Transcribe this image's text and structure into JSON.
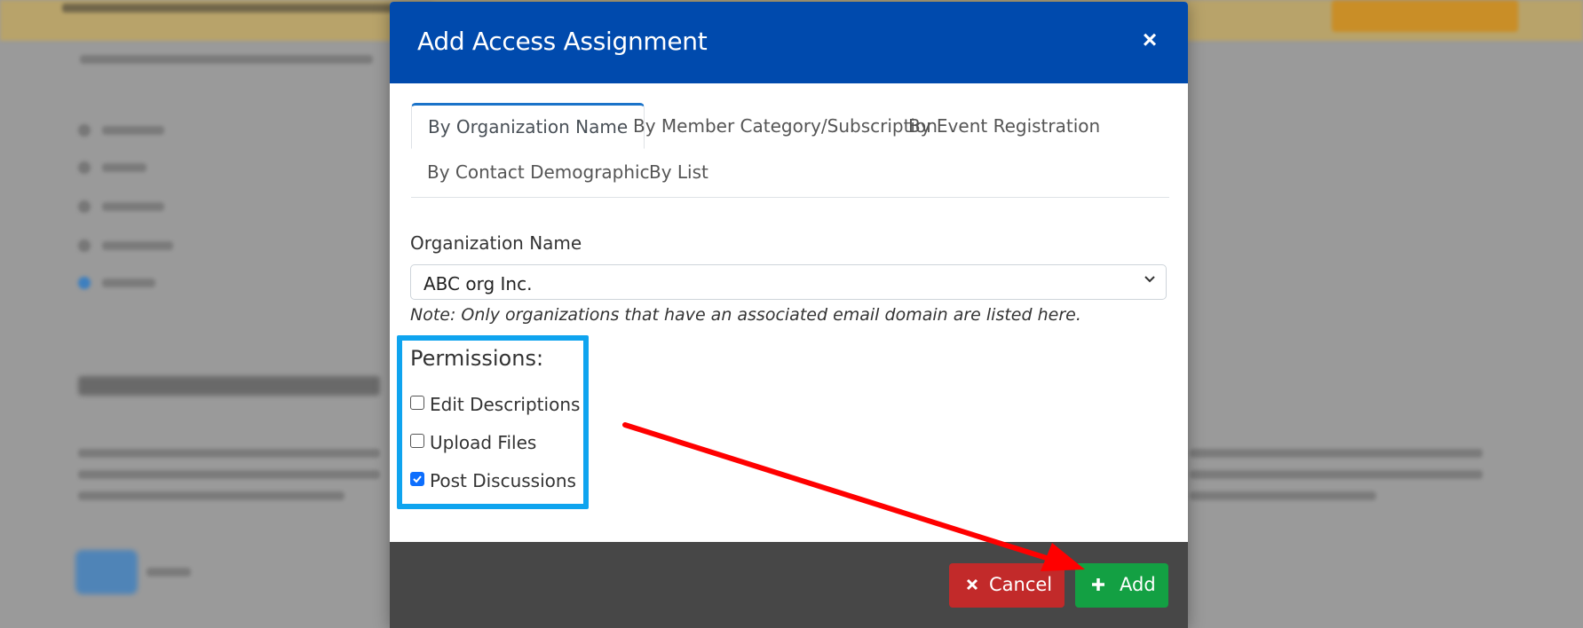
{
  "modal": {
    "title": "Add Access Assignment",
    "close_symbol": "×"
  },
  "tabs": [
    {
      "label": "By Organization Name",
      "active": true
    },
    {
      "label": "By Member Category/Subscription",
      "active": false
    },
    {
      "label": "By Event Registration",
      "active": false
    },
    {
      "label": "By Contact Demographic",
      "active": false
    },
    {
      "label": "By List",
      "active": false
    }
  ],
  "organization": {
    "label": "Organization Name",
    "selected": "ABC org Inc.",
    "note": "Note: Only organizations that have an associated email domain are listed here."
  },
  "permissions": {
    "title": "Permissions:",
    "items": [
      {
        "label": "Edit Descriptions",
        "checked": false
      },
      {
        "label": "Upload Files",
        "checked": false
      },
      {
        "label": "Post Discussions",
        "checked": true
      }
    ]
  },
  "footer": {
    "cancel_label": "Cancel",
    "add_label": "Add"
  },
  "colors": {
    "header": "#004aad",
    "highlight_box": "#0fa4ef",
    "annotation_arrow": "#ff0000",
    "cancel": "#c22a2a",
    "add": "#13a043"
  },
  "icons": {
    "close": "close-icon",
    "cancel": "x-icon",
    "add": "plus-icon",
    "select": "chevron-down-icon"
  }
}
